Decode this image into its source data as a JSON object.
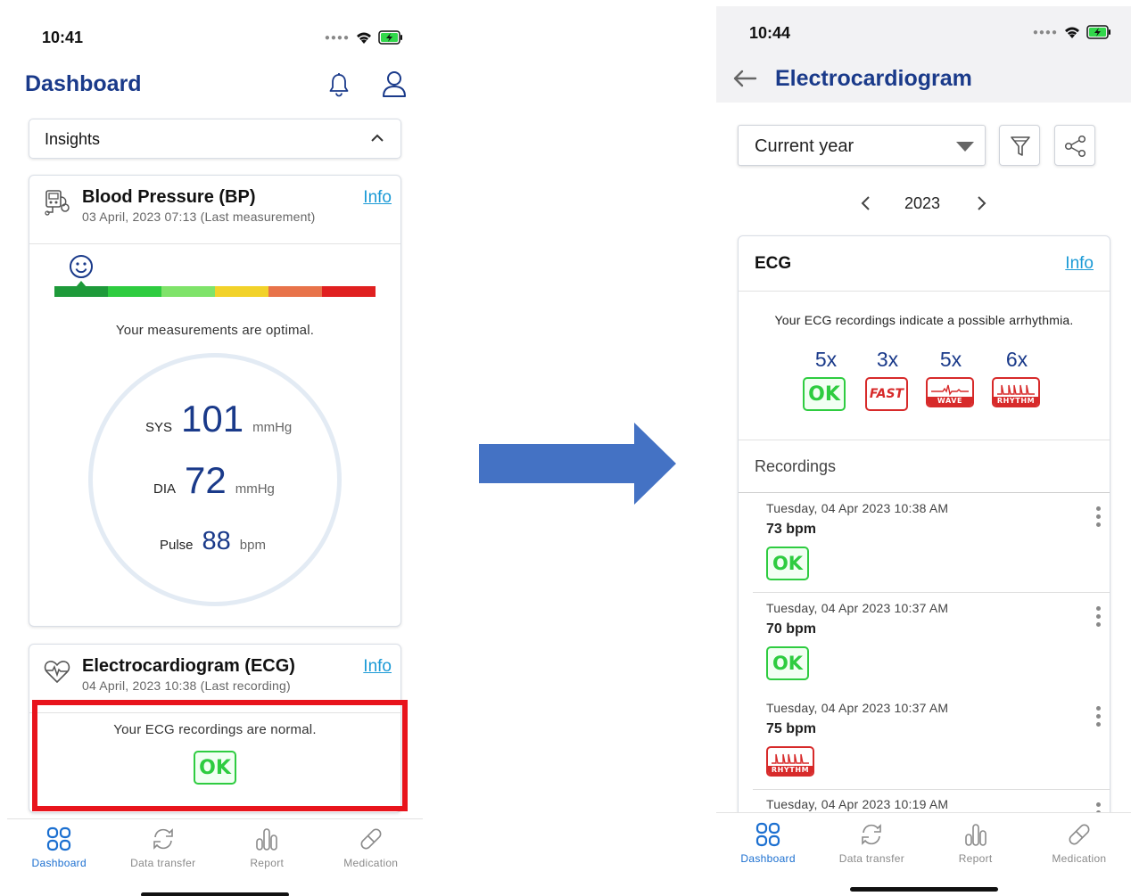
{
  "left": {
    "status": {
      "time": "10:41"
    },
    "header": {
      "title": "Dashboard",
      "icons": [
        "bell-icon",
        "user-icon"
      ]
    },
    "insights": {
      "label": "Insights"
    },
    "bp_card": {
      "title": "Blood Pressure (BP)",
      "info": "Info",
      "subtitle": "03 April, 2023 07:13 (Last measurement)",
      "scale_colors": [
        "#1e9a3a",
        "#2ecc40",
        "#7fe36a",
        "#f2d22a",
        "#e8734a",
        "#e02020"
      ],
      "status_text": "Your measurements are optimal.",
      "sys_label": "SYS",
      "sys_value": "101",
      "sys_unit": "mmHg",
      "dia_label": "DIA",
      "dia_value": "72",
      "dia_unit": "mmHg",
      "pulse_label": "Pulse",
      "pulse_value": "88",
      "pulse_unit": "bpm"
    },
    "ecg_card": {
      "title": "Electrocardiogram (ECG)",
      "info": "Info",
      "subtitle": "04 April, 2023 10:38 (Last recording)",
      "status_text": "Your ECG recordings are normal.",
      "badge": "OK"
    },
    "tabs": [
      "Dashboard",
      "Data transfer",
      "Report",
      "Medication"
    ]
  },
  "right": {
    "status": {
      "time": "10:44"
    },
    "header": {
      "title": "Electrocardiogram"
    },
    "period_select": {
      "value": "Current year"
    },
    "year_nav": {
      "year": "2023"
    },
    "ecg_card": {
      "title": "ECG",
      "info": "Info",
      "status_text": "Your ECG recordings indicate a possible arrhythmia.",
      "summary": [
        {
          "count": "5x",
          "badge": "OK"
        },
        {
          "count": "3x",
          "badge": "FAST"
        },
        {
          "count": "5x",
          "badge": "WAVE"
        },
        {
          "count": "6x",
          "badge": "RHYTHM"
        }
      ]
    },
    "recordings": {
      "title": "Recordings",
      "items": [
        {
          "date": "Tuesday, 04 Apr 2023 10:38 AM",
          "bpm": "73 bpm",
          "badge": "OK"
        },
        {
          "date": "Tuesday, 04 Apr 2023 10:37 AM",
          "bpm": "70 bpm",
          "badge": "OK"
        },
        {
          "date": "Tuesday, 04 Apr 2023 10:37 AM",
          "bpm": "75 bpm",
          "badge": "RHYTHM"
        },
        {
          "date": "Tuesday, 04 Apr 2023 10:19 AM",
          "bpm": "",
          "badge": ""
        }
      ]
    },
    "tabs": [
      "Dashboard",
      "Data transfer",
      "Report",
      "Medication"
    ]
  },
  "colors": {
    "accent_blue": "#1a3a8a",
    "link": "#1b9ad6",
    "tab_active": "#1b6fd0",
    "highlight": "#e8141c",
    "arrow": "#4472c4",
    "ok_green": "#2ecc40",
    "alert_red": "#d72a2a"
  }
}
